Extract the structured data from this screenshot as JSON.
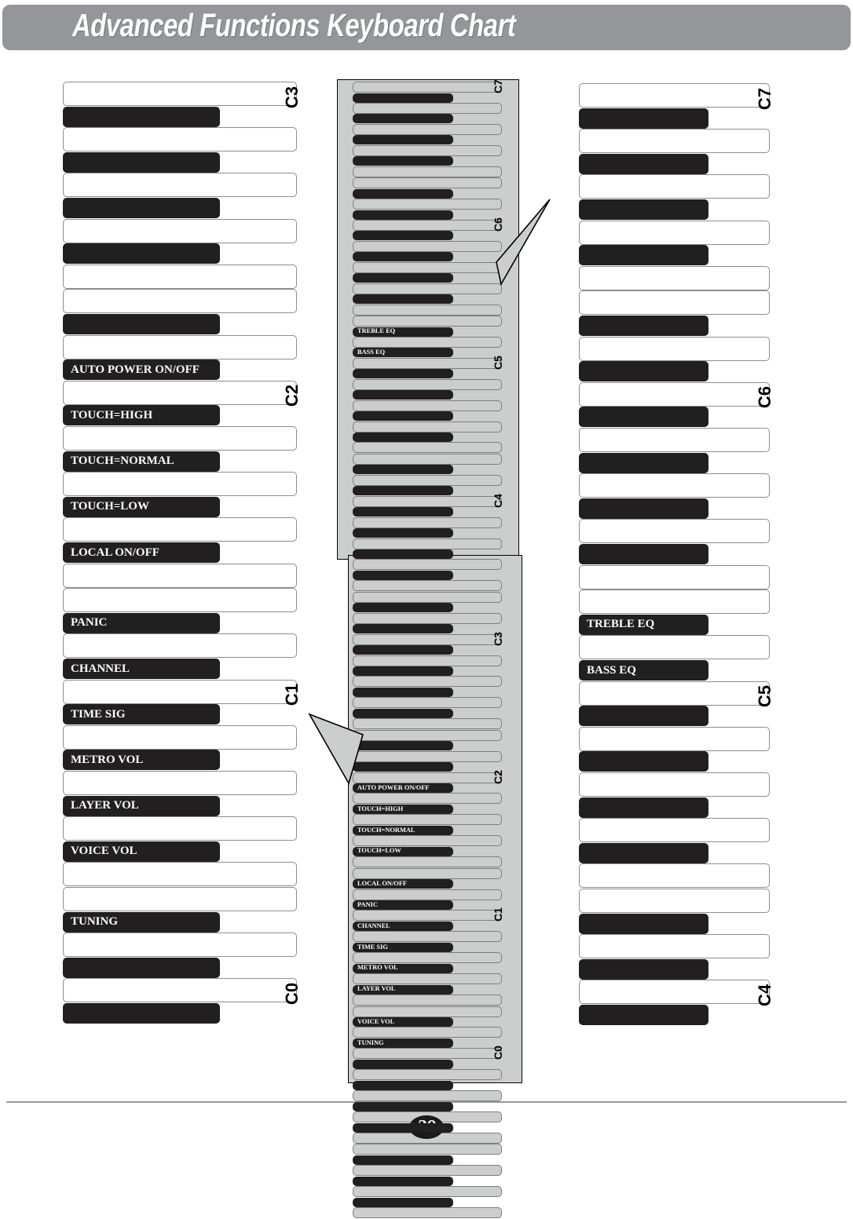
{
  "header": {
    "title": "Advanced Functions Keyboard Chart",
    "banner_color": "#949699"
  },
  "page": {
    "number": "29"
  },
  "colors": {
    "white_key": "#ffffff",
    "black_key": "#211f20",
    "gray_key": "#cccecd",
    "outline": "#8d8d8d",
    "banner": "#949699"
  },
  "diagrams": [
    {
      "id": "left-detail-keyboard",
      "name": "lower-octaves-detail",
      "style": "white",
      "octave_marks": [
        "C3",
        "C2",
        "C1",
        "C0"
      ],
      "labels": [
        "AUTO POWER ON/OFF",
        "TOUCH=HIGH",
        "TOUCH=NORMAL",
        "TOUCH=LOW",
        "LOCAL ON/OFF",
        "PANIC",
        "CHANNEL",
        "TIME SIG",
        "METRO VOL",
        "LAYER VOL",
        "VOICE VOL",
        "TUNING"
      ]
    },
    {
      "id": "middle-full-keyboard",
      "name": "full-keyboard-overview",
      "style": "gray",
      "octave_marks": [
        "C7",
        "C6",
        "C5",
        "C4",
        "C3",
        "C2",
        "C1",
        "C0"
      ],
      "labels": [
        "TREBLE EQ",
        "BASS EQ",
        "AUTO POWER ON/OFF",
        "TOUCH=HIGH",
        "TOUCH=NORMAL",
        "TOUCH=LOW",
        "LOCAL ON/OFF",
        "PANIC",
        "CHANNEL",
        "TIME SIG",
        "METRO VOL",
        "LAYER VOL",
        "VOICE VOL",
        "TUNING"
      ]
    },
    {
      "id": "right-detail-keyboard",
      "name": "upper-octaves-detail",
      "style": "white",
      "octave_marks": [
        "C7",
        "C6",
        "C5",
        "C4"
      ],
      "labels": [
        "TREBLE EQ",
        "BASS EQ"
      ]
    }
  ],
  "left_keyboard": {
    "name": "left-keyboard",
    "notes": [
      {
        "type": "white",
        "note": "C3",
        "mark": "C3"
      },
      {
        "type": "black",
        "note": "B2",
        "label": ""
      },
      {
        "type": "white",
        "note": "B2"
      },
      {
        "type": "white",
        "note": "A2"
      },
      {
        "type": "black",
        "note": "A#2",
        "label": ""
      },
      {
        "type": "white",
        "note": "G2"
      },
      {
        "type": "black",
        "note": "G#2",
        "label": ""
      },
      {
        "type": "white",
        "note": "F2"
      },
      {
        "type": "white",
        "note": "E2"
      },
      {
        "type": "black",
        "note": "F#2",
        "label": ""
      },
      {
        "type": "white",
        "note": "D2"
      },
      {
        "type": "black",
        "note": "D#2",
        "label": ""
      },
      {
        "type": "white",
        "note": "C2",
        "mark": "C2"
      },
      {
        "type": "black",
        "note": "C#2",
        "label": "AUTO POWER ON/OFF"
      },
      {
        "type": "white",
        "note": "B1"
      },
      {
        "type": "black",
        "note": "B1b",
        "label": "TOUCH=HIGH"
      },
      {
        "type": "white",
        "note": "A1"
      },
      {
        "type": "black",
        "note": "A1b",
        "label": "TOUCH=NORMAL"
      },
      {
        "type": "white",
        "note": "G1"
      },
      {
        "type": "black",
        "note": "G1b",
        "label": "TOUCH=LOW"
      },
      {
        "type": "white",
        "note": "F1"
      },
      {
        "type": "white",
        "note": "E1"
      },
      {
        "type": "black",
        "note": "E1b",
        "label": "LOCAL ON/OFF"
      },
      {
        "type": "white",
        "note": "D1"
      },
      {
        "type": "black",
        "note": "D1b",
        "label": "PANIC"
      },
      {
        "type": "white",
        "note": "C1",
        "mark": "C1"
      },
      {
        "type": "white",
        "note": "B0"
      },
      {
        "type": "black",
        "note": "B0b",
        "label": "CHANNEL"
      },
      {
        "type": "white",
        "note": "A0"
      },
      {
        "type": "black",
        "note": "A0b",
        "label": "TIME SIG"
      },
      {
        "type": "white",
        "note": "G0"
      },
      {
        "type": "black",
        "note": "G0b",
        "label": "METRO VOL"
      },
      {
        "type": "white",
        "note": "F0"
      },
      {
        "type": "white",
        "note": "E0"
      },
      {
        "type": "black",
        "note": "E0b",
        "label": "LAYER VOL"
      },
      {
        "type": "white",
        "note": "D0"
      },
      {
        "type": "black",
        "note": "D0b",
        "label": "VOICE VOL"
      },
      {
        "type": "white",
        "note": "C0",
        "mark": "C0"
      },
      {
        "type": "white",
        "note": "B-1"
      },
      {
        "type": "black",
        "note": "B-1b",
        "label": "TUNING"
      },
      {
        "type": "white",
        "note": "A-1"
      }
    ]
  },
  "middle_keyboard": {
    "name": "middle-keyboard",
    "upper_labels": [
      "TREBLE EQ",
      "BASS EQ"
    ],
    "lower_labels": [
      "AUTO POWER ON/OFF",
      "TOUCH=HIGH",
      "TOUCH=NORMAL",
      "TOUCH=LOW",
      "LOCAL ON/OFF",
      "PANIC",
      "CHANNEL",
      "TIME SIG",
      "METRO VOL",
      "LAYER VOL",
      "VOICE VOL",
      "TUNING"
    ],
    "octave_marks": [
      "C7",
      "C6",
      "C5",
      "C4",
      "C3",
      "C2",
      "C1",
      "C0"
    ]
  },
  "right_keyboard": {
    "name": "right-keyboard",
    "labels": [
      "TREBLE EQ",
      "BASS EQ"
    ],
    "octave_marks": [
      "C7",
      "C6",
      "C5",
      "C4"
    ]
  }
}
